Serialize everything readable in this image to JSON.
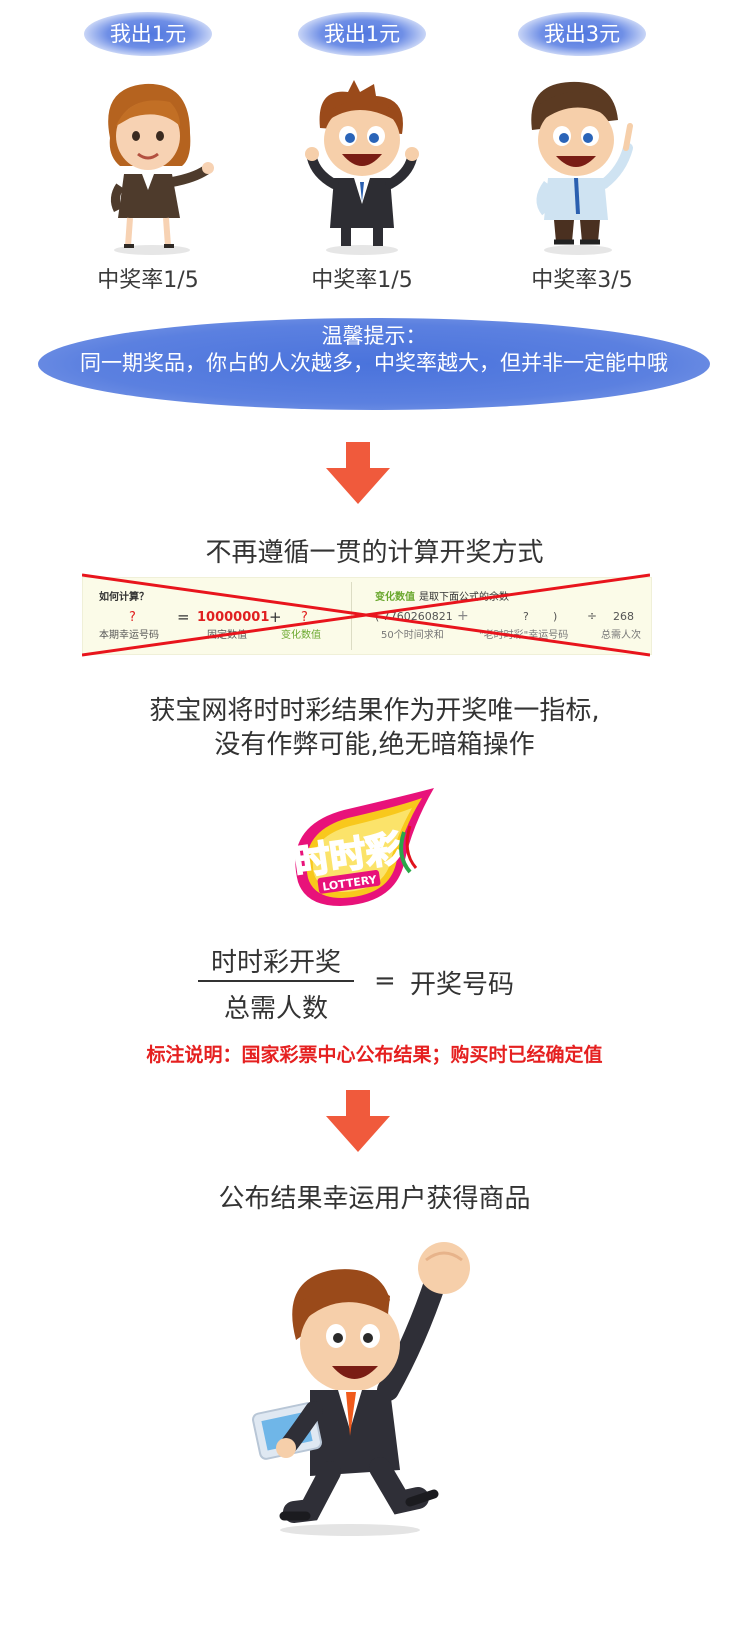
{
  "participants": [
    {
      "pay": "我出1元",
      "rate": "中奖率1/5"
    },
    {
      "pay": "我出1元",
      "rate": "中奖率1/5"
    },
    {
      "pay": "我出3元",
      "rate": "中奖率3/5"
    }
  ],
  "tip": {
    "title": "温馨提示：",
    "body": "同一期奖品，你占的人次越多，中奖率越大，但并非一定能中哦"
  },
  "headline_old": "不再遵循一贯的计算开奖方式",
  "old_formula": {
    "how": "如何计算？",
    "q1": "?",
    "eq": "=",
    "fixed": "10000001",
    "plus": "+",
    "q2": "?",
    "lucky_label": "本期幸运号码",
    "fixed_label": "固定数值",
    "var_label": "变化数值",
    "var_desc_a": "变化数值",
    "var_desc_b": "是取下面公式的余数",
    "sum_val": "( 7760260821",
    "plus2": "+",
    "q3": "?",
    "paren": ")",
    "div": "÷",
    "total": "268",
    "sum_label": "50个时间求和",
    "ssc_label": "\"老时时彩\"幸运号码",
    "people_label": "总需人次"
  },
  "statement": {
    "line1": "获宝网将时时彩结果作为开奖唯一指标,",
    "line2": "没有作弊可能,绝无暗箱操作"
  },
  "logo": {
    "text": "时时彩",
    "sub": "LOTTERY"
  },
  "formula": {
    "numerator": "时时彩开奖",
    "denominator": "总需人数",
    "eq": "=",
    "result": "开奖号码"
  },
  "note": "标注说明：国家彩票中心公布结果；购买时已经确定值",
  "final": "公布结果幸运用户获得商品",
  "colors": {
    "accent_blue": "#4a73dc",
    "arrow_red": "#f05a3c",
    "note_red": "#e52020",
    "cross_red": "#e8141c"
  }
}
